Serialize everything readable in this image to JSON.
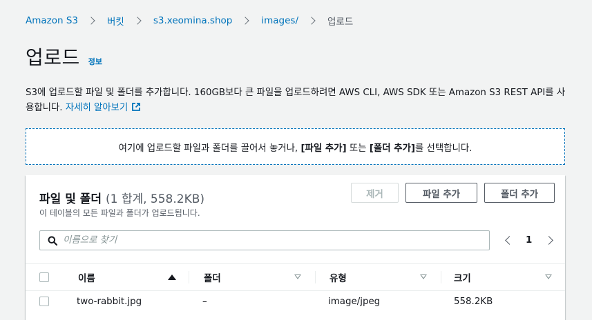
{
  "breadcrumb": {
    "items": [
      "Amazon S3",
      "버킷",
      "s3.xeomina.shop",
      "images/"
    ],
    "current": "업로드"
  },
  "page": {
    "title": "업로드",
    "info_label": "정보"
  },
  "description": {
    "text": "S3에 업로드할 파일 및 폴더를 추가합니다. 160GB보다 큰 파일을 업로드하려면 AWS CLI, AWS SDK 또는 Amazon S3 REST API를 사용합니다.",
    "learn_more": "자세히 알아보기"
  },
  "dropzone": {
    "prefix": "여기에 업로드할 파일과 폴더를 끌어서 놓거나,",
    "add_files": "[파일 추가]",
    "middle": "또는",
    "add_folder": "[폴더 추가]",
    "suffix": "를 선택합니다."
  },
  "files_panel": {
    "title": "파일 및 폴더",
    "count": "(1 합계, 558.2KB)",
    "subtitle": "이 테이블의 모든 파일과 폴더가 업로드됩니다.",
    "buttons": {
      "remove": "제거",
      "add_files": "파일 추가",
      "add_folder": "폴더 추가"
    },
    "search": {
      "placeholder": "이름으로 찾기",
      "value": ""
    },
    "pagination": {
      "current_page": "1"
    },
    "columns": [
      "이름",
      "폴더",
      "유형",
      "크기"
    ],
    "rows": [
      {
        "name": "two-rabbit.jpg",
        "folder": "–",
        "type": "image/jpeg",
        "size": "558.2KB"
      }
    ]
  },
  "colors": {
    "link": "#0073bb",
    "background": "#f2f3f3",
    "text": "#16191f",
    "secondary_text": "#545b64"
  }
}
